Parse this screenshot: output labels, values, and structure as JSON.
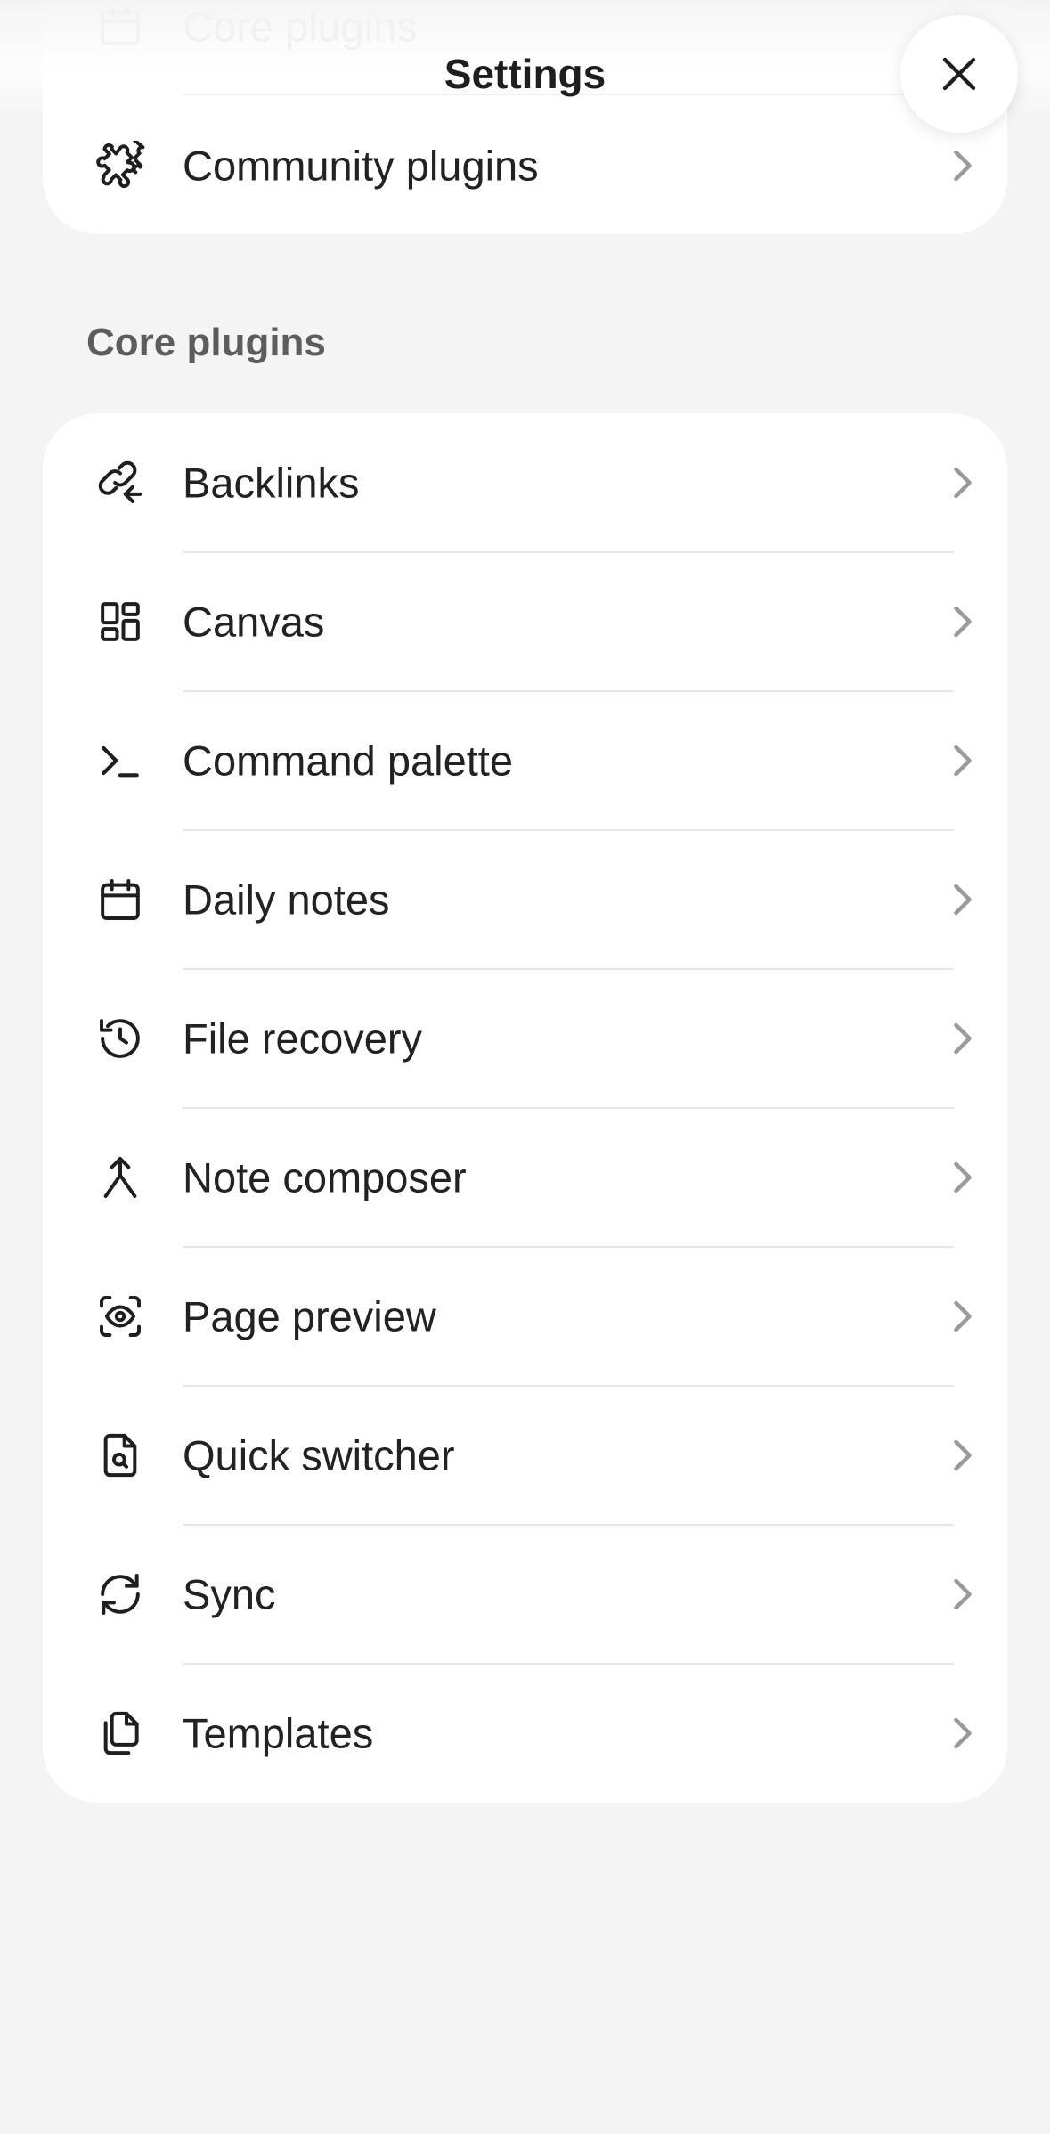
{
  "header": {
    "title": "Settings",
    "close_icon": "close-icon"
  },
  "top_list": {
    "items": [
      {
        "label": "Core plugins",
        "icon": "calendar-box-icon"
      },
      {
        "label": "Community plugins",
        "icon": "puzzle-icon"
      }
    ]
  },
  "core_plugins": {
    "heading": "Core plugins",
    "items": [
      {
        "label": "Backlinks",
        "icon": "backlink-icon"
      },
      {
        "label": "Canvas",
        "icon": "layout-dashboard-icon"
      },
      {
        "label": "Command palette",
        "icon": "terminal-icon"
      },
      {
        "label": "Daily notes",
        "icon": "calendar-icon"
      },
      {
        "label": "File recovery",
        "icon": "history-icon"
      },
      {
        "label": "Note composer",
        "icon": "merge-icon"
      },
      {
        "label": "Page preview",
        "icon": "scan-eye-icon"
      },
      {
        "label": "Quick switcher",
        "icon": "file-search-icon"
      },
      {
        "label": "Sync",
        "icon": "refresh-icon"
      },
      {
        "label": "Templates",
        "icon": "files-icon"
      }
    ]
  },
  "colors": {
    "background": "#f4f4f4",
    "card": "#ffffff",
    "text": "#222222",
    "muted": "#5d5d5d"
  }
}
